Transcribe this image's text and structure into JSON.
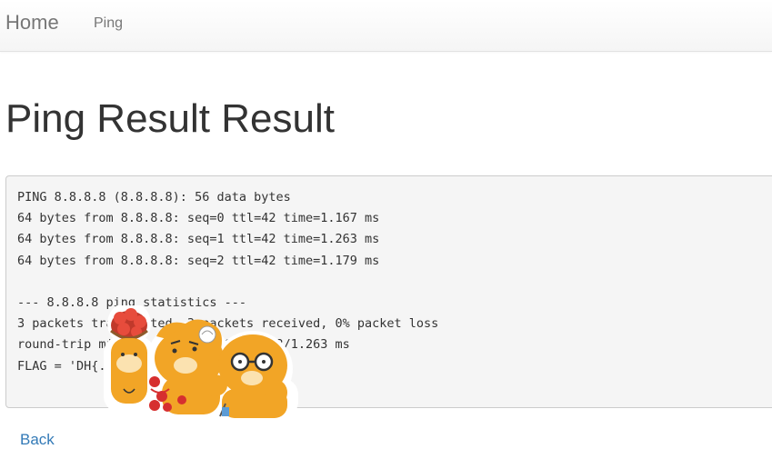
{
  "navbar": {
    "brand": "Home",
    "links": [
      "Ping"
    ]
  },
  "page": {
    "title": "Ping Result Result"
  },
  "result": {
    "lines": [
      "PING 8.8.8.8 (8.8.8.8): 56 data bytes",
      "64 bytes from 8.8.8.8: seq=0 ttl=42 time=1.167 ms",
      "64 bytes from 8.8.8.8: seq=1 ttl=42 time=1.263 ms",
      "64 bytes from 8.8.8.8: seq=2 ttl=42 time=1.179 ms",
      "",
      "--- 8.8.8.8 ping statistics ---",
      "3 packets transmitted, 3 packets received, 0% packet loss",
      "round-trip min/avg/max = 1.167/1.203/1.263 ms",
      "FLAG = 'DH{...}'"
    ]
  },
  "sticker": {
    "icon": "lion-characters-sticker"
  },
  "footer": {
    "back_label": "Back"
  },
  "colors": {
    "link": "#337ab7",
    "nav_text": "#777777",
    "pre_bg": "#f5f5f5",
    "sticker_orange": "#f2a526"
  }
}
